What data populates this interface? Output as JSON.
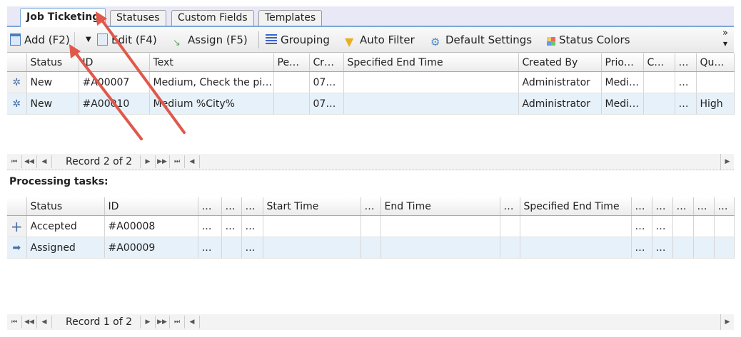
{
  "tabs": [
    "Job Ticketing",
    "Statuses",
    "Custom Fields",
    "Templates"
  ],
  "toolbar": {
    "add": "Add (F2)",
    "edit": "Edit (F4)",
    "assign": "Assign (F5)",
    "grouping": "Grouping",
    "auto_filter": "Auto Filter",
    "default_settings": "Default Settings",
    "status_colors": "Status Colors",
    "overflow": "»"
  },
  "tickets": {
    "columns": [
      "",
      "Status",
      "ID",
      "Text",
      "Pe…",
      "Cr…",
      "Specified End Time",
      "Created By",
      "Prio…",
      "C…",
      "…",
      "Qu…"
    ],
    "rows": [
      {
        "icon": "gear-icon",
        "cells": [
          "New",
          "#A00007",
          "Medium, Check the pi…",
          "",
          "07…",
          "",
          "Administrator",
          "Medi…",
          "",
          "…",
          ""
        ]
      },
      {
        "icon": "gear-icon",
        "cells": [
          "New",
          "#A00010",
          "Medium %City%",
          "",
          "07…",
          "",
          "Administrator",
          "Medi…",
          "",
          "…",
          "High"
        ]
      }
    ],
    "nav": "Record 2 of 2"
  },
  "tasks": {
    "title": "Processing tasks:",
    "columns": [
      "",
      "Status",
      "ID",
      "…",
      "…",
      "…",
      "Start Time",
      "…",
      "End Time",
      "…",
      "Specified End Time",
      "…",
      "…",
      "…",
      "…",
      "…"
    ],
    "rows": [
      {
        "icon": "plus-icon",
        "cells": [
          "Accepted",
          "#A00008",
          "…",
          "…",
          "…",
          "",
          "",
          "",
          "",
          "",
          "…",
          "…",
          "",
          "",
          ""
        ]
      },
      {
        "icon": "arrow-right-icon",
        "cells": [
          "Assigned",
          "#A00009",
          "…",
          "",
          "…",
          "",
          "",
          "",
          "",
          "",
          "…",
          "…",
          "",
          "",
          ""
        ]
      }
    ],
    "nav": "Record 1 of 2"
  },
  "colors": {
    "accent": "#7aa7d8",
    "selected_row": "#e7f1fa",
    "annotation_arrow": "#e0584a"
  }
}
